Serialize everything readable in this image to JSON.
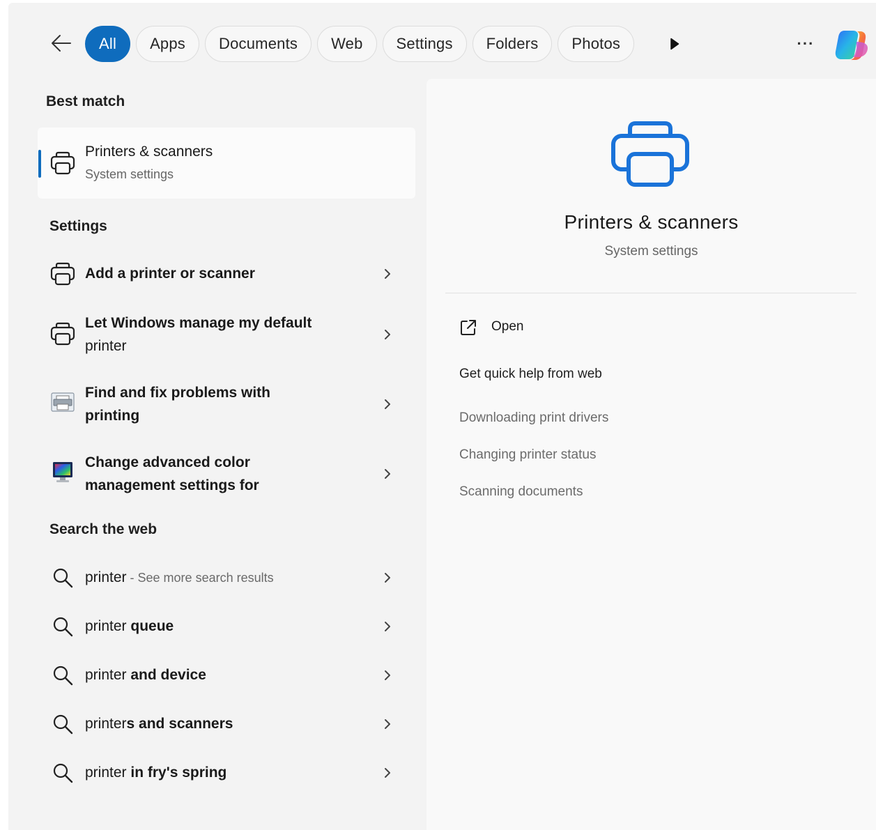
{
  "filters": {
    "chips": [
      "All",
      "Apps",
      "Documents",
      "Web",
      "Settings",
      "Folders",
      "Photos"
    ],
    "active": "All",
    "more_label": "···"
  },
  "best_match": {
    "heading": "Best match",
    "title": "Printers & scanners",
    "subtitle": "System settings"
  },
  "settings": {
    "heading": "Settings",
    "items": [
      {
        "line1": "Add a printer or scanner",
        "line2": ""
      },
      {
        "line1": "Let Windows manage my default",
        "line2": "printer"
      },
      {
        "line1": "Find and fix problems with",
        "line2": "printing"
      },
      {
        "line1": "Change advanced color",
        "line2": "management settings for"
      }
    ]
  },
  "web": {
    "heading": "Search the web",
    "items": [
      {
        "prefix": "printer",
        "suffix": "",
        "extra": " - See more search results"
      },
      {
        "prefix": "printer",
        "suffix": " queue",
        "extra": ""
      },
      {
        "prefix": "printer",
        "suffix": " and device",
        "extra": ""
      },
      {
        "prefix": "printer",
        "suffix": "s and scanners",
        "extra": ""
      },
      {
        "prefix": "printer",
        "suffix": " in fry's spring",
        "extra": ""
      }
    ]
  },
  "detail": {
    "title": "Printers & scanners",
    "subtitle": "System settings",
    "open_label": "Open",
    "help_heading": "Get quick help from web",
    "help_links": [
      "Downloading print drivers",
      "Changing printer status",
      "Scanning documents"
    ]
  },
  "colors": {
    "accent": "#0f6cbd",
    "printer_icon": "#1a73d9"
  }
}
